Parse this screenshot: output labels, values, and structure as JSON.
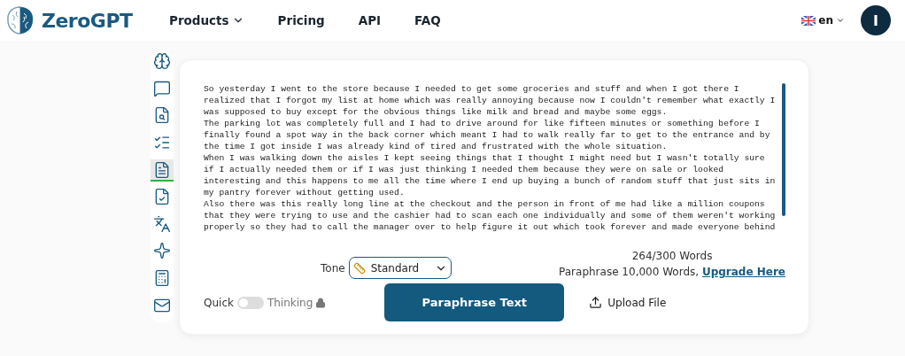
{
  "header": {
    "logo": "ZeroGPT",
    "nav": [
      {
        "label": "Products",
        "dropdown": true
      },
      {
        "label": "Pricing",
        "dropdown": false
      },
      {
        "label": "API",
        "dropdown": false
      },
      {
        "label": "FAQ",
        "dropdown": false
      }
    ],
    "language": "en",
    "avatar": "I"
  },
  "sidebar": {
    "items": [
      {
        "kind": "brain",
        "selected": false
      },
      {
        "kind": "chat",
        "selected": false
      },
      {
        "kind": "search",
        "selected": false
      },
      {
        "kind": "list",
        "selected": false
      },
      {
        "kind": "paraphrase",
        "selected": true
      },
      {
        "kind": "doc",
        "selected": false
      },
      {
        "kind": "translate",
        "selected": false
      },
      {
        "kind": "spark",
        "selected": false
      },
      {
        "kind": "calc",
        "selected": false
      },
      {
        "kind": "mail",
        "selected": false
      }
    ]
  },
  "editor": {
    "lines": [
      "So yesterday I went to the store because I needed to get some groceries and stuff and when I got there I",
      "realized that I forgot my list at home which was really annoying because now I couldn't remember what exactly I",
      "was supposed to buy except for the obvious things like milk and bread and maybe some eggs.",
      "The parking lot was completely full and I had to drive around for like fifteen minutes or something before I",
      "finally found a spot way in the back corner which meant I had to walk really far to get to the entrance and by",
      "the time I got inside I was already kind of tired and frustrated with the whole situation.",
      "When I was walking down the aisles I kept seeing things that I thought I might need but I wasn't totally sure",
      "if I actually needed them or if I was just thinking I needed them because they were on sale or looked",
      "interesting and this happens to me all the time where I end up buying a bunch of random stuff that just sits in",
      "my pantry forever without getting used.",
      "Also there was this really long line at the checkout and the person in front of me had like a million coupons",
      "that they were trying to use and the cashier had to scan each one individually and some of them weren't working",
      "properly so they had to call the manager over to help figure it out which took forever and made everyone behind"
    ]
  },
  "tone": {
    "label": "Tone",
    "value": "Standard"
  },
  "word_count": "264/300 Words",
  "upgrade": {
    "text": "Paraphrase 10,000 Words,",
    "link": "Upgrade Here"
  },
  "mode": {
    "left": "Quick",
    "right": "Thinking",
    "on": false,
    "locked": true
  },
  "primary_button": "Paraphrase Text",
  "upload": "Upload File"
}
